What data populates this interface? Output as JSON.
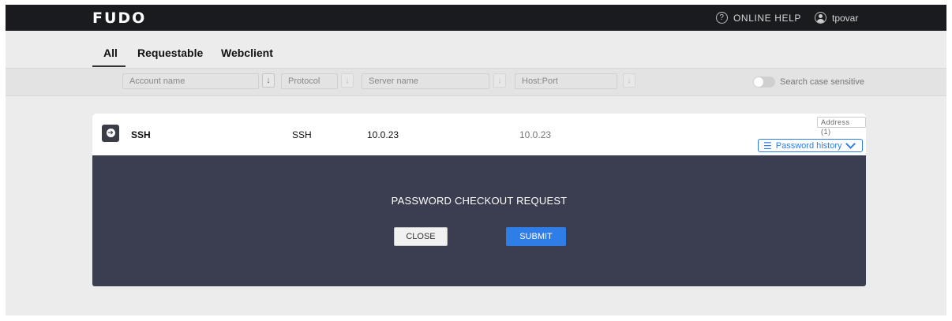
{
  "header": {
    "logo": "FUDO",
    "help_label": "ONLINE HELP",
    "user_name": "tpovar"
  },
  "tabs": [
    {
      "label": "All",
      "active": true
    },
    {
      "label": "Requestable",
      "active": false
    },
    {
      "label": "Webclient",
      "active": false
    }
  ],
  "filters": {
    "account_placeholder": "Account name",
    "protocol_placeholder": "Protocol",
    "server_placeholder": "Server name",
    "hostport_placeholder": "Host:Port",
    "case_sensitive_label": "Search case sensitive"
  },
  "account_row": {
    "name": "SSH",
    "protocol": "SSH",
    "server": "10.0.23",
    "host": "10.0.23",
    "address_badge": "Address (1)",
    "password_history_label": "Password history"
  },
  "checkout": {
    "title": "PASSWORD CHECKOUT REQUEST",
    "close_label": "CLOSE",
    "submit_label": "SUBMIT"
  },
  "colors": {
    "accent": "#2f7de6",
    "header_bg": "#1a1b1f",
    "panel_bg": "#3b3d50"
  }
}
